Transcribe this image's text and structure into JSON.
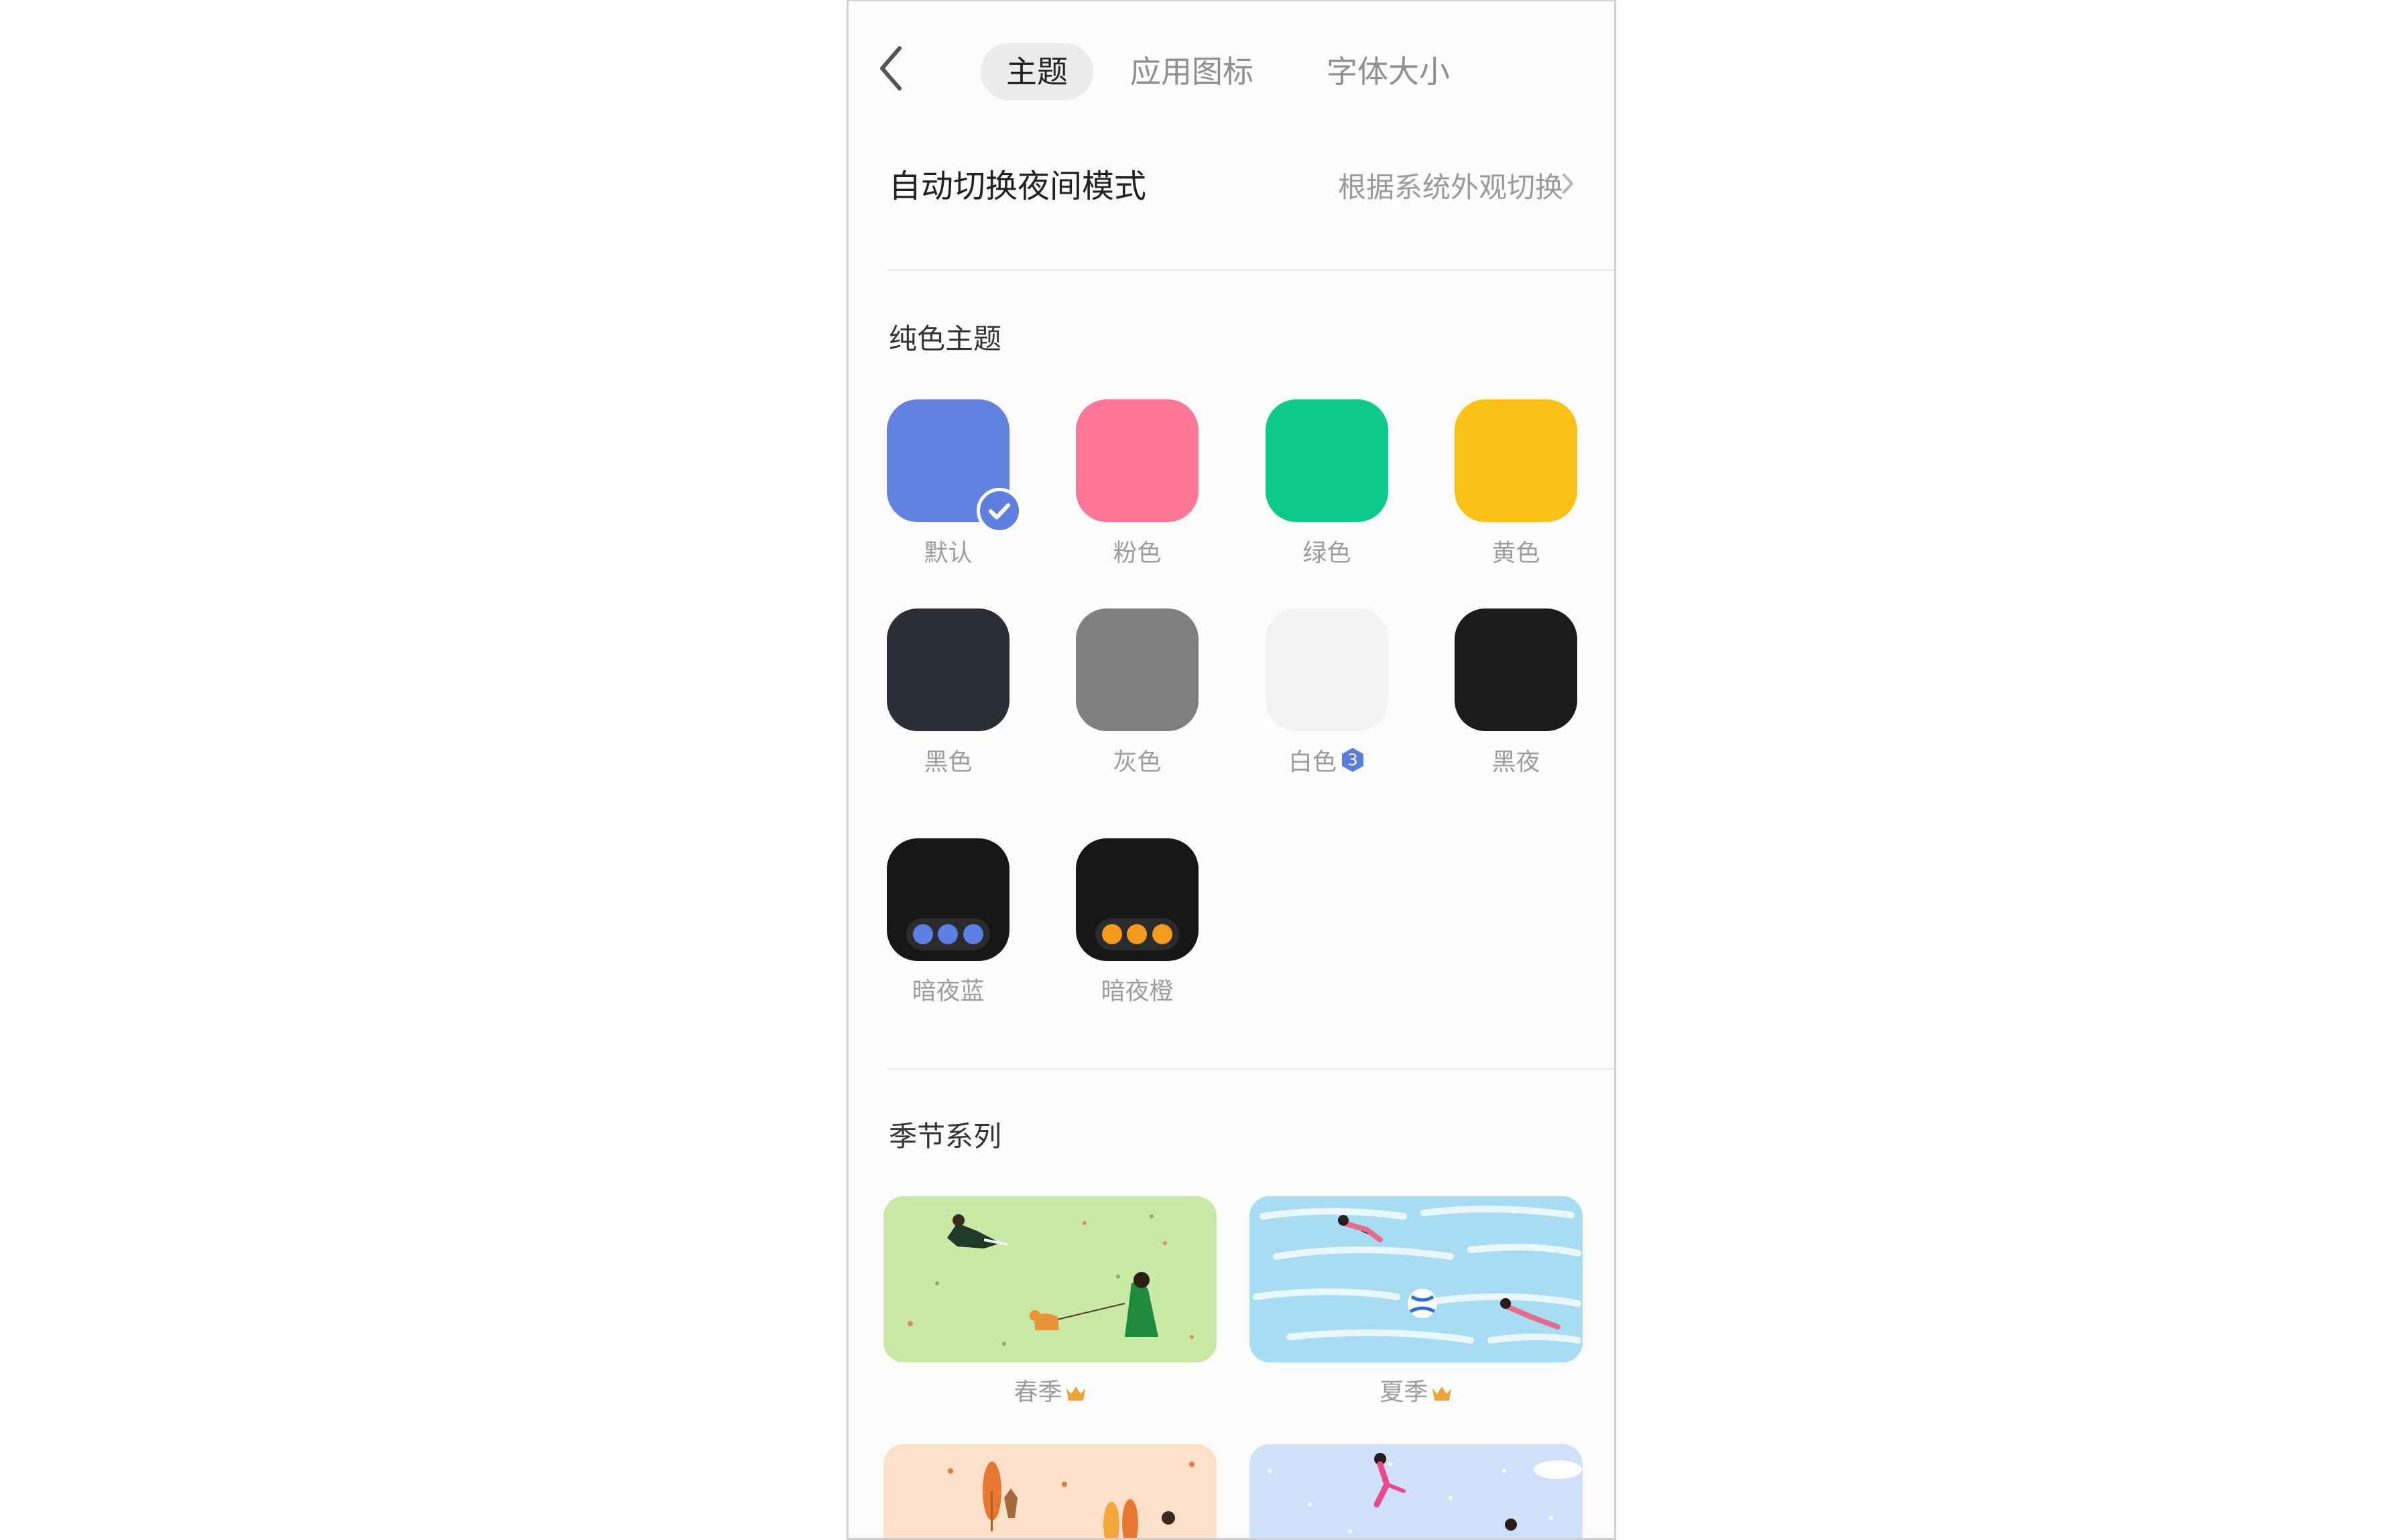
{
  "header": {
    "tabs": [
      {
        "label": "主题",
        "active": true
      },
      {
        "label": "应用图标",
        "active": false
      },
      {
        "label": "字体大小",
        "active": false
      }
    ]
  },
  "auto_night": {
    "title": "自动切换夜间模式",
    "value": "根据系统外观切换"
  },
  "solid_themes": {
    "title": "纯色主题",
    "items": [
      {
        "label": "默认",
        "color": "#6382e0",
        "selected": true
      },
      {
        "label": "粉色",
        "color": "#fe7797"
      },
      {
        "label": "绿色",
        "color": "#0dc98a"
      },
      {
        "label": "黄色",
        "color": "#fbc117"
      },
      {
        "label": "黑色",
        "color": "#2a2d37"
      },
      {
        "label": "灰色",
        "color": "#7f7f80"
      },
      {
        "label": "白色",
        "color": "#f3f3f3",
        "badge": "3",
        "badge_color": "#5a7fd8"
      },
      {
        "label": "黑夜",
        "color": "#1b1b1b"
      },
      {
        "label": "暗夜蓝",
        "color": "#161616",
        "dot_color": "#5b7fe3"
      },
      {
        "label": "暗夜橙",
        "color": "#161616",
        "dot_color": "#f49a1c"
      }
    ]
  },
  "seasons": {
    "title": "季节系列",
    "items": [
      {
        "label": "春季",
        "bg": "#c9e9a6",
        "premium": true
      },
      {
        "label": "夏季",
        "bg": "#a8dcf2",
        "premium": true
      },
      {
        "label": "",
        "bg": "#fde0c9",
        "premium": false
      },
      {
        "label": "",
        "bg": "#cfe0fa",
        "premium": false
      }
    ]
  },
  "colors": {
    "accent": "#6382e0",
    "crown": "#f0a238"
  }
}
